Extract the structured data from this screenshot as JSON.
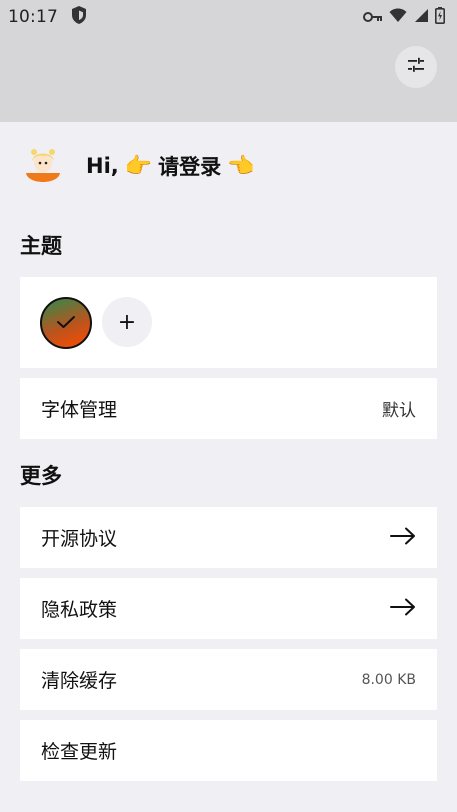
{
  "status_bar": {
    "time": "10:17",
    "icons": [
      "shield-icon",
      "key-icon",
      "wifi-icon",
      "signal-icon",
      "battery-charging-icon"
    ]
  },
  "header": {
    "filter_icon": "tune-icon"
  },
  "user": {
    "greeting_prefix": "Hi,",
    "hand_right": "👉",
    "login_text": "请登录",
    "hand_left": "👈"
  },
  "sections": {
    "theme_title": "主题",
    "more_title": "更多"
  },
  "theme": {
    "add_symbol": "+",
    "selected_colors": [
      "#2e8b4e",
      "#ff4a00"
    ]
  },
  "rows": {
    "font": {
      "label": "字体管理",
      "value": "默认"
    },
    "open_source": {
      "label": "开源协议"
    },
    "privacy": {
      "label": "隐私政策"
    },
    "clear_cache": {
      "label": "清除缓存",
      "value": "8.00 KB"
    },
    "check_update": {
      "label": "检查更新"
    }
  }
}
